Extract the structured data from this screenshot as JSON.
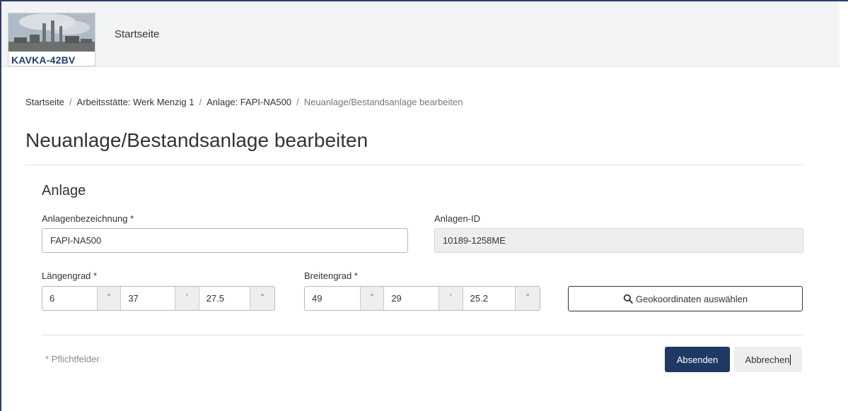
{
  "header": {
    "logo_text": "KAVKA-42BV",
    "nav_home": "Startseite"
  },
  "breadcrumb": {
    "items": [
      "Startseite",
      "Arbeitsstätte: Werk Menzig 1",
      "Anlage: FAPI-NA500"
    ],
    "current": "Neuanlage/Bestandsanlage bearbeiten",
    "separator": "/"
  },
  "page": {
    "title": "Neuanlage/Bestandsanlage bearbeiten"
  },
  "form": {
    "section_title": "Anlage",
    "name_label": "Anlagenbezeichnung *",
    "name_value": "FAPI-NA500",
    "id_label": "Anlagen-ID",
    "id_value": "10189-1258ME",
    "longitude": {
      "label": "Längengrad *",
      "degrees": "6",
      "minutes": "37",
      "seconds": "27.5",
      "deg_unit": "°",
      "min_unit": "'",
      "sec_unit": "\""
    },
    "latitude": {
      "label": "Breitengrad *",
      "degrees": "49",
      "minutes": "29",
      "seconds": "25.2",
      "deg_unit": "°",
      "min_unit": "'",
      "sec_unit": "\""
    },
    "geo_button_label": "Geokoordinaten auswählen",
    "geo_button_icon": "search-icon",
    "required_note": "* Pflichtfelder"
  },
  "actions": {
    "submit_label": "Absenden",
    "cancel_label": "Abbrechen"
  },
  "colors": {
    "primary": "#1f3864",
    "logo_text": "#1f3d70",
    "header_bg": "#f2f3f5"
  }
}
